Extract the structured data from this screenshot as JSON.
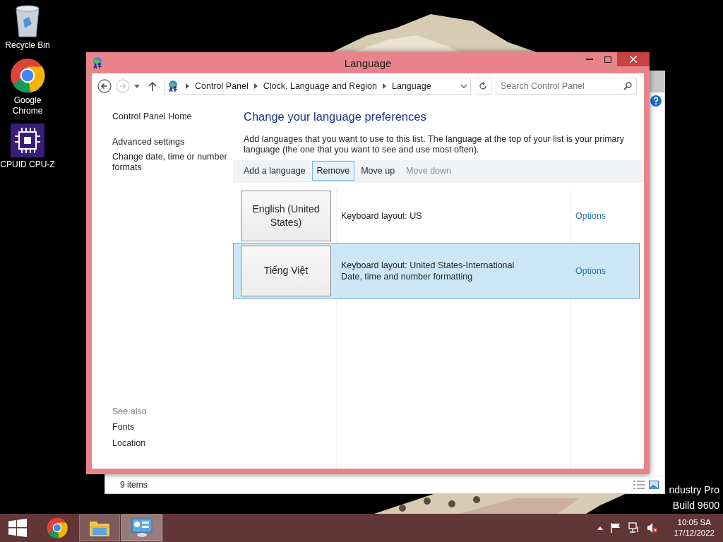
{
  "desktop_icons": [
    {
      "kind": "bin",
      "label": "Recycle Bin"
    },
    {
      "kind": "chrome",
      "label": "Google Chrome"
    },
    {
      "kind": "cpu",
      "label": "CPUID CPU-Z"
    }
  ],
  "desktop_text": [
    "ndustry Pro",
    "Build 9600"
  ],
  "background_window": {
    "status": "9 items"
  },
  "window": {
    "title": "Language",
    "breadcrumb": [
      "Control Panel",
      "Clock, Language and Region",
      "Language"
    ],
    "search": {
      "placeholder": "Search Control Panel"
    },
    "sidebar": {
      "links": [
        "Control Panel Home",
        "Advanced settings",
        "Change date, time or number formats"
      ],
      "see_also": {
        "heading": "See also",
        "links": [
          "Fonts",
          "Location"
        ]
      }
    },
    "heading": "Change your language preferences",
    "description": "Add languages that you want to use to this list. The language at the top of your list is your primary language (the one that you want to see and use most often).",
    "toolbar": [
      {
        "label": "Add a language",
        "selected": false,
        "disabled": false
      },
      {
        "label": "Remove",
        "selected": true,
        "disabled": false
      },
      {
        "label": "Move up",
        "selected": false,
        "disabled": false
      },
      {
        "label": "Move down",
        "selected": false,
        "disabled": true
      }
    ],
    "languages": [
      {
        "name": "English (United States)",
        "details": [
          "Keyboard layout: US"
        ],
        "options": "Options",
        "selected": false
      },
      {
        "name": "Tiếng Việt",
        "details": [
          "Keyboard layout: United States-International",
          "Date, time and number formatting"
        ],
        "options": "Options",
        "selected": true
      }
    ]
  },
  "taskbar": {
    "apps": [
      {
        "kind": "chrome",
        "selected": false,
        "open": false
      },
      {
        "kind": "explorer",
        "selected": false,
        "open": true
      },
      {
        "kind": "control",
        "selected": true,
        "open": true
      }
    ],
    "time": "10:05 SA",
    "date": "17/12/2022"
  }
}
